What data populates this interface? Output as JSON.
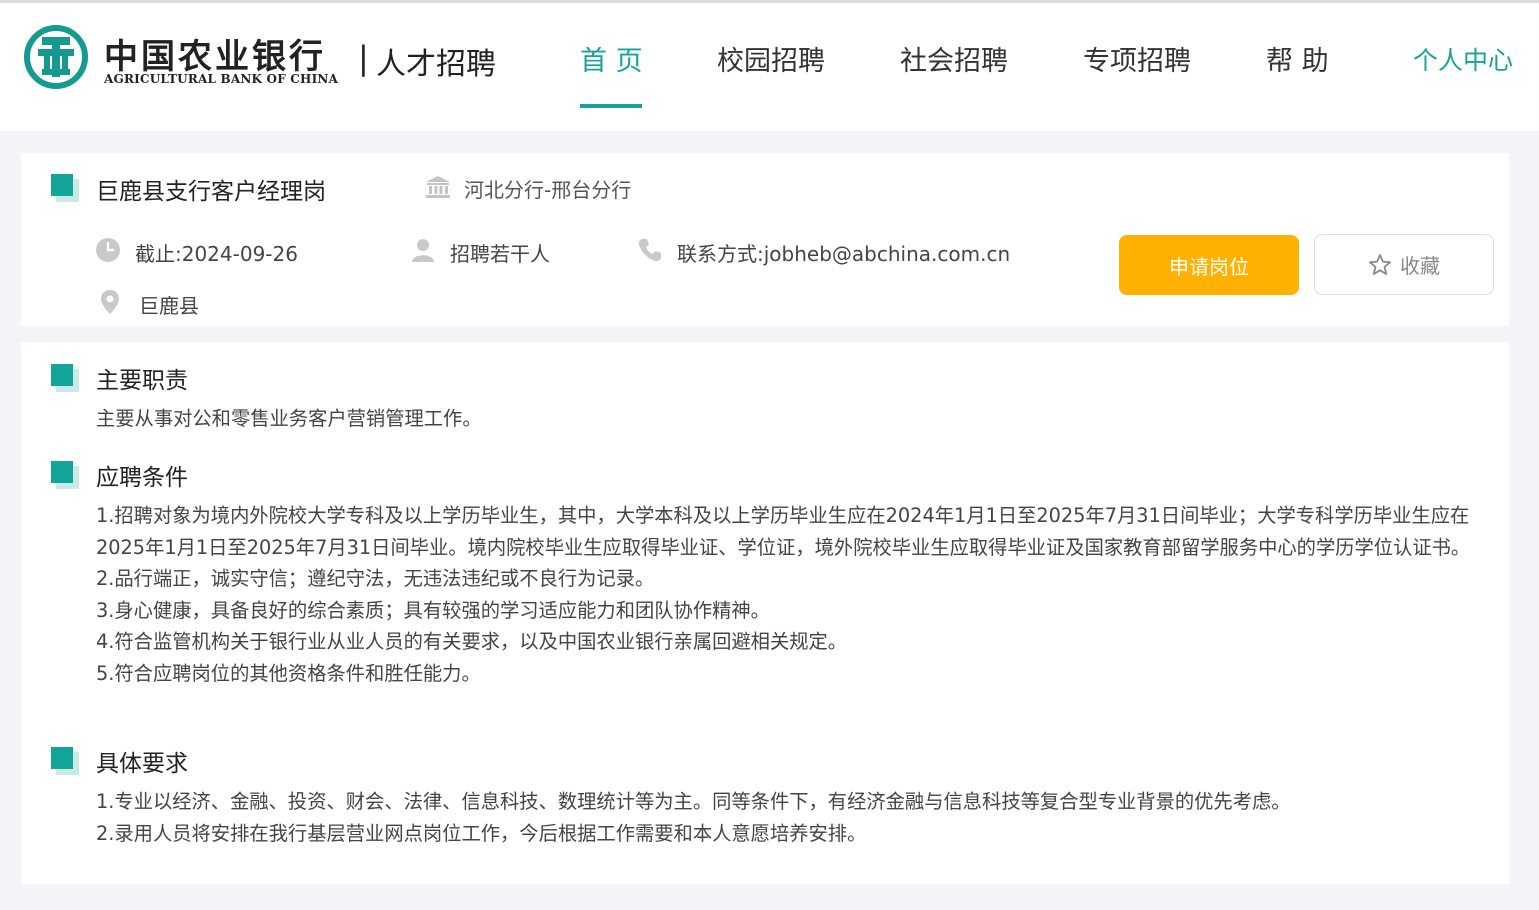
{
  "header": {
    "logo_cn": "中国农业银行",
    "logo_en": "AGRICULTURAL BANK OF CHINA",
    "logo_sep": "|",
    "logo_sub": "人才招聘",
    "nav": {
      "home": "首 页",
      "campus": "校园招聘",
      "social": "社会招聘",
      "special": "专项招聘",
      "help": "帮 助"
    },
    "user_center": "个人中心"
  },
  "job": {
    "title": "巨鹿县支行客户经理岗",
    "branch": "河北分行-邢台分行",
    "deadline": "截止:2024-09-26",
    "headcount": "招聘若干人",
    "contact": "联系方式:jobheb@abchina.com.cn",
    "location": "巨鹿县",
    "apply_label": "申请岗位",
    "favorite_label": "收藏"
  },
  "sections": {
    "duties": {
      "title": "主要职责",
      "lines": [
        "主要从事对公和零售业务客户营销管理工作。"
      ]
    },
    "conditions": {
      "title": "应聘条件",
      "lines": [
        "1.招聘对象为境内外院校大学专科及以上学历毕业生，其中，大学本科及以上学历毕业生应在2024年1月1日至2025年7月31日间毕业；大学专科学历毕业生应在2025年1月1日至2025年7月31日间毕业。境内院校毕业生应取得毕业证、学位证，境外院校毕业生应取得毕业证及国家教育部留学服务中心的学历学位认证书。",
        "2.品行端正，诚实守信；遵纪守法，无违法违纪或不良行为记录。",
        "3.身心健康，具备良好的综合素质；具有较强的学习适应能力和团队协作精神。",
        "4.符合监管机构关于银行业从业人员的有关要求，以及中国农业银行亲属回避相关规定。",
        "5.符合应聘岗位的其他资格条件和胜任能力。"
      ]
    },
    "requirements": {
      "title": "具体要求",
      "lines": [
        "1.专业以经济、金融、投资、财会、法律、信息科技、数理统计等为主。同等条件下，有经济金融与信息科技等复合型专业背景的优先考虑。",
        "2.录用人员将安排在我行基层营业网点岗位工作，今后根据工作需要和本人意愿培养安排。"
      ]
    }
  },
  "colors": {
    "accent": "#17a398",
    "apply": "#ffb000"
  }
}
